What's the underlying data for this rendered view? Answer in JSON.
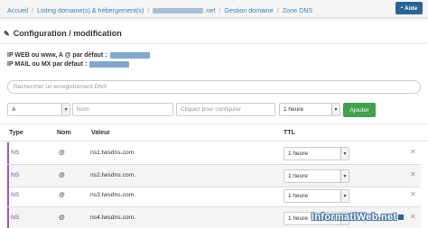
{
  "breadcrumb": {
    "items": [
      "Accueil",
      "Listing domaine(s) & hébergement(s)",
      ".net",
      "Gestion domaine",
      "Zone DNS"
    ]
  },
  "help_button": {
    "label": "Aide",
    "icon": "book-icon"
  },
  "title": {
    "text": "Configuration / modification",
    "icon": "edit-icon"
  },
  "info": {
    "ip_web_label": "IP WEB ou www, A @ par défaut :",
    "ip_mail_label": "IP MAIL ou MX par défaut :"
  },
  "search": {
    "placeholder": "Rechercher un enregistrement DNS"
  },
  "add_form": {
    "type_value": "A",
    "name_placeholder": "Nom",
    "value_placeholder": "Cliquez pour configurer",
    "ttl_value": "1 heure",
    "add_label": "Ajouter"
  },
  "table": {
    "headers": [
      "Type",
      "Nom",
      "Valeur",
      "TTL"
    ],
    "rows": [
      {
        "type": "NS",
        "name": "@",
        "value": "ns1.lwsdns.com.",
        "ttl": "1 heure"
      },
      {
        "type": "NS",
        "name": "@",
        "value": "ns2.lwsdns.com.",
        "ttl": "1 heure"
      },
      {
        "type": "NS",
        "name": "@",
        "value": "ns3.lwsdns.com.",
        "ttl": "1 heure"
      },
      {
        "type": "NS",
        "name": "@",
        "value": "ns4.lwsdns.com.",
        "ttl": "1 heure"
      }
    ],
    "delete_icon": "close-icon"
  },
  "watermark": {
    "text": "InformatiWeb.net"
  },
  "colors": {
    "link": "#3a7fc1",
    "help_button": "#2a6496",
    "add_button": "#44a04f",
    "row_accent": "#9b59b6"
  }
}
